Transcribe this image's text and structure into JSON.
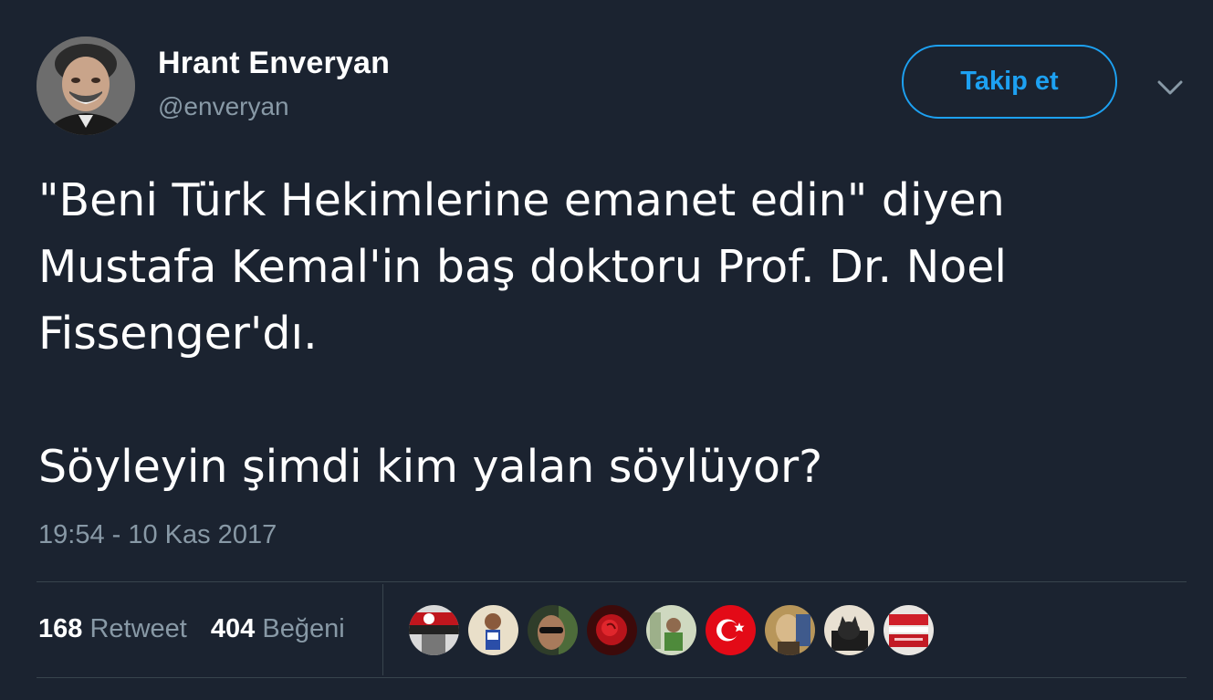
{
  "user": {
    "name": "Hrant Enveryan",
    "handle": "@enveryan"
  },
  "actions": {
    "follow_label": "Takip et"
  },
  "tweet": {
    "line1": "\"Beni Türk Hekimlerine emanet edin\" diyen",
    "line2": "Mustafa Kemal'in baş doktoru Prof. Dr. Noel",
    "line3": "Fissenger'dı.",
    "line4": "Söyleyin şimdi kim yalan söylüyor?",
    "timestamp": "19:54 - 10 Kas 2017"
  },
  "stats": {
    "retweet_count": "168",
    "retweet_label": "Retweet",
    "like_count": "404",
    "like_label": "Beğeni"
  },
  "liker_avatars": [
    "flag-avatar",
    "runner-avatar",
    "sunglasses-avatar",
    "rose-avatar",
    "green-photo-avatar",
    "turkish-flag-avatar",
    "portrait-avatar",
    "cat-avatar",
    "red-sign-avatar"
  ],
  "colors": {
    "background": "#1b2330",
    "accent": "#1da1f2",
    "muted": "#8899a6",
    "divider": "#38444d"
  }
}
